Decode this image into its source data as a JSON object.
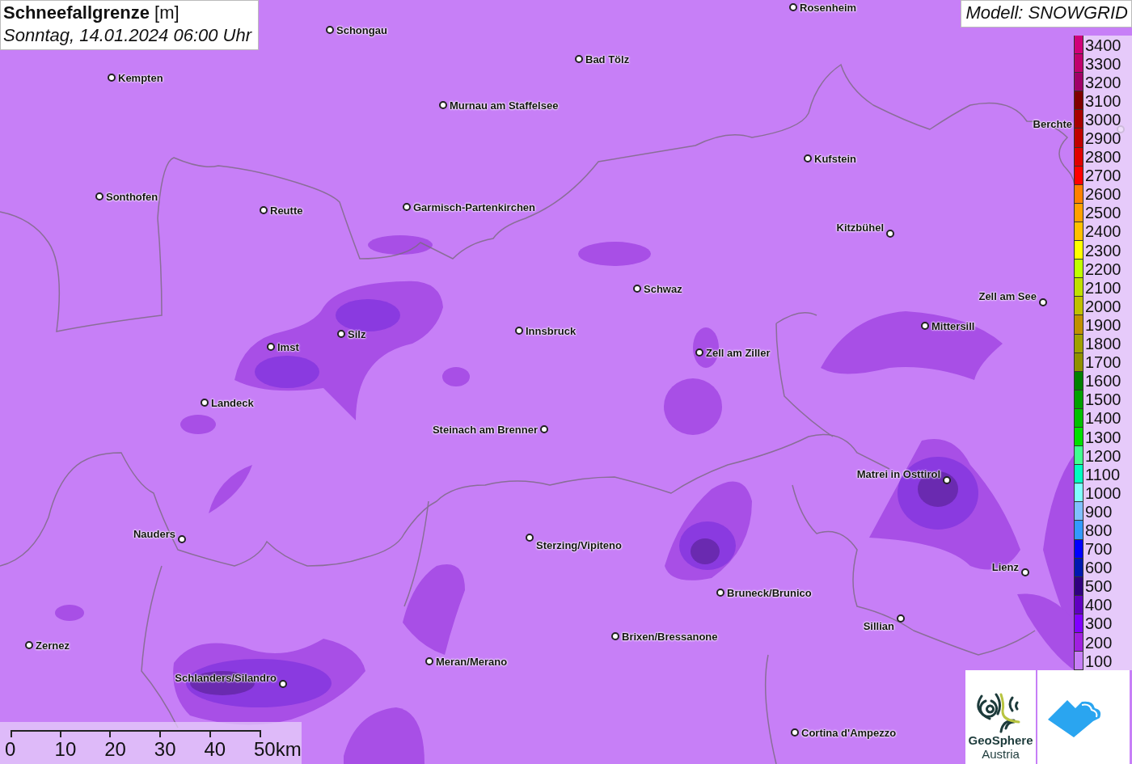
{
  "title": {
    "name": "Schneefallgrenze",
    "unit": "[m]",
    "date": "Sonntag, 14.01.2024 06:00 Uhr"
  },
  "model": "Modell: SNOWGRID",
  "cities": [
    {
      "name": "Rosenheim"
    },
    {
      "name": "Schongau"
    },
    {
      "name": "Bad Tölz"
    },
    {
      "name": "Kempten"
    },
    {
      "name": "Murnau am Staffelsee"
    },
    {
      "name": "Berchte"
    },
    {
      "name": "Kufstein"
    },
    {
      "name": "Sonthofen"
    },
    {
      "name": "Reutte"
    },
    {
      "name": "Garmisch-Partenkirchen"
    },
    {
      "name": "Kitzbühel"
    },
    {
      "name": "Schwaz"
    },
    {
      "name": "Zell am See"
    },
    {
      "name": "Mittersill"
    },
    {
      "name": "Silz"
    },
    {
      "name": "Innsbruck"
    },
    {
      "name": "Imst"
    },
    {
      "name": "Zell am Ziller"
    },
    {
      "name": "Landeck"
    },
    {
      "name": "Steinach am Brenner"
    },
    {
      "name": "Matrei in Osttirol"
    },
    {
      "name": "Nauders"
    },
    {
      "name": "Sterzing/Vipiteno"
    },
    {
      "name": "Lienz"
    },
    {
      "name": "Bruneck/Brunico"
    },
    {
      "name": "Sillian"
    },
    {
      "name": "Brixen/Bressanone"
    },
    {
      "name": "Zernez"
    },
    {
      "name": "Meran/Merano"
    },
    {
      "name": "Schlanders/Silandro"
    },
    {
      "name": "Cortina d'Ampezzo"
    }
  ],
  "legend": [
    {
      "label": "3400",
      "color": "#d0007a"
    },
    {
      "label": "3300",
      "color": "#c0006e"
    },
    {
      "label": "3200",
      "color": "#a00068"
    },
    {
      "label": "3100",
      "color": "#800000"
    },
    {
      "label": "3000",
      "color": "#a80000"
    },
    {
      "label": "2900",
      "color": "#c00000"
    },
    {
      "label": "2800",
      "color": "#e00000"
    },
    {
      "label": "2700",
      "color": "#ff0000"
    },
    {
      "label": "2600",
      "color": "#ff8000"
    },
    {
      "label": "2500",
      "color": "#ffa000"
    },
    {
      "label": "2400",
      "color": "#ffc000"
    },
    {
      "label": "2300",
      "color": "#ffff00"
    },
    {
      "label": "2200",
      "color": "#c0ff00"
    },
    {
      "label": "2100",
      "color": "#c0e000"
    },
    {
      "label": "2000",
      "color": "#c0c000"
    },
    {
      "label": "1900",
      "color": "#c09000"
    },
    {
      "label": "1800",
      "color": "#a0a000"
    },
    {
      "label": "1700",
      "color": "#909000"
    },
    {
      "label": "1600",
      "color": "#008000"
    },
    {
      "label": "1500",
      "color": "#00a000"
    },
    {
      "label": "1400",
      "color": "#00c000"
    },
    {
      "label": "1300",
      "color": "#00e000"
    },
    {
      "label": "1200",
      "color": "#40ff90"
    },
    {
      "label": "1100",
      "color": "#00ffc0"
    },
    {
      "label": "1000",
      "color": "#80ffff"
    },
    {
      "label": "900",
      "color": "#80c0ff"
    },
    {
      "label": "800",
      "color": "#3399ff"
    },
    {
      "label": "700",
      "color": "#0000ff"
    },
    {
      "label": "600",
      "color": "#0018b0"
    },
    {
      "label": "500",
      "color": "#300080"
    },
    {
      "label": "400",
      "color": "#6000c0"
    },
    {
      "label": "300",
      "color": "#8000ff"
    },
    {
      "label": "200",
      "color": "#a020e0"
    },
    {
      "label": "100",
      "color": "#c77ff7"
    }
  ],
  "scale": {
    "ticks": [
      "0",
      "10",
      "20",
      "30",
      "40",
      "50km"
    ]
  },
  "logos": {
    "name": "GeoSphere",
    "subtitle": "Austria"
  }
}
